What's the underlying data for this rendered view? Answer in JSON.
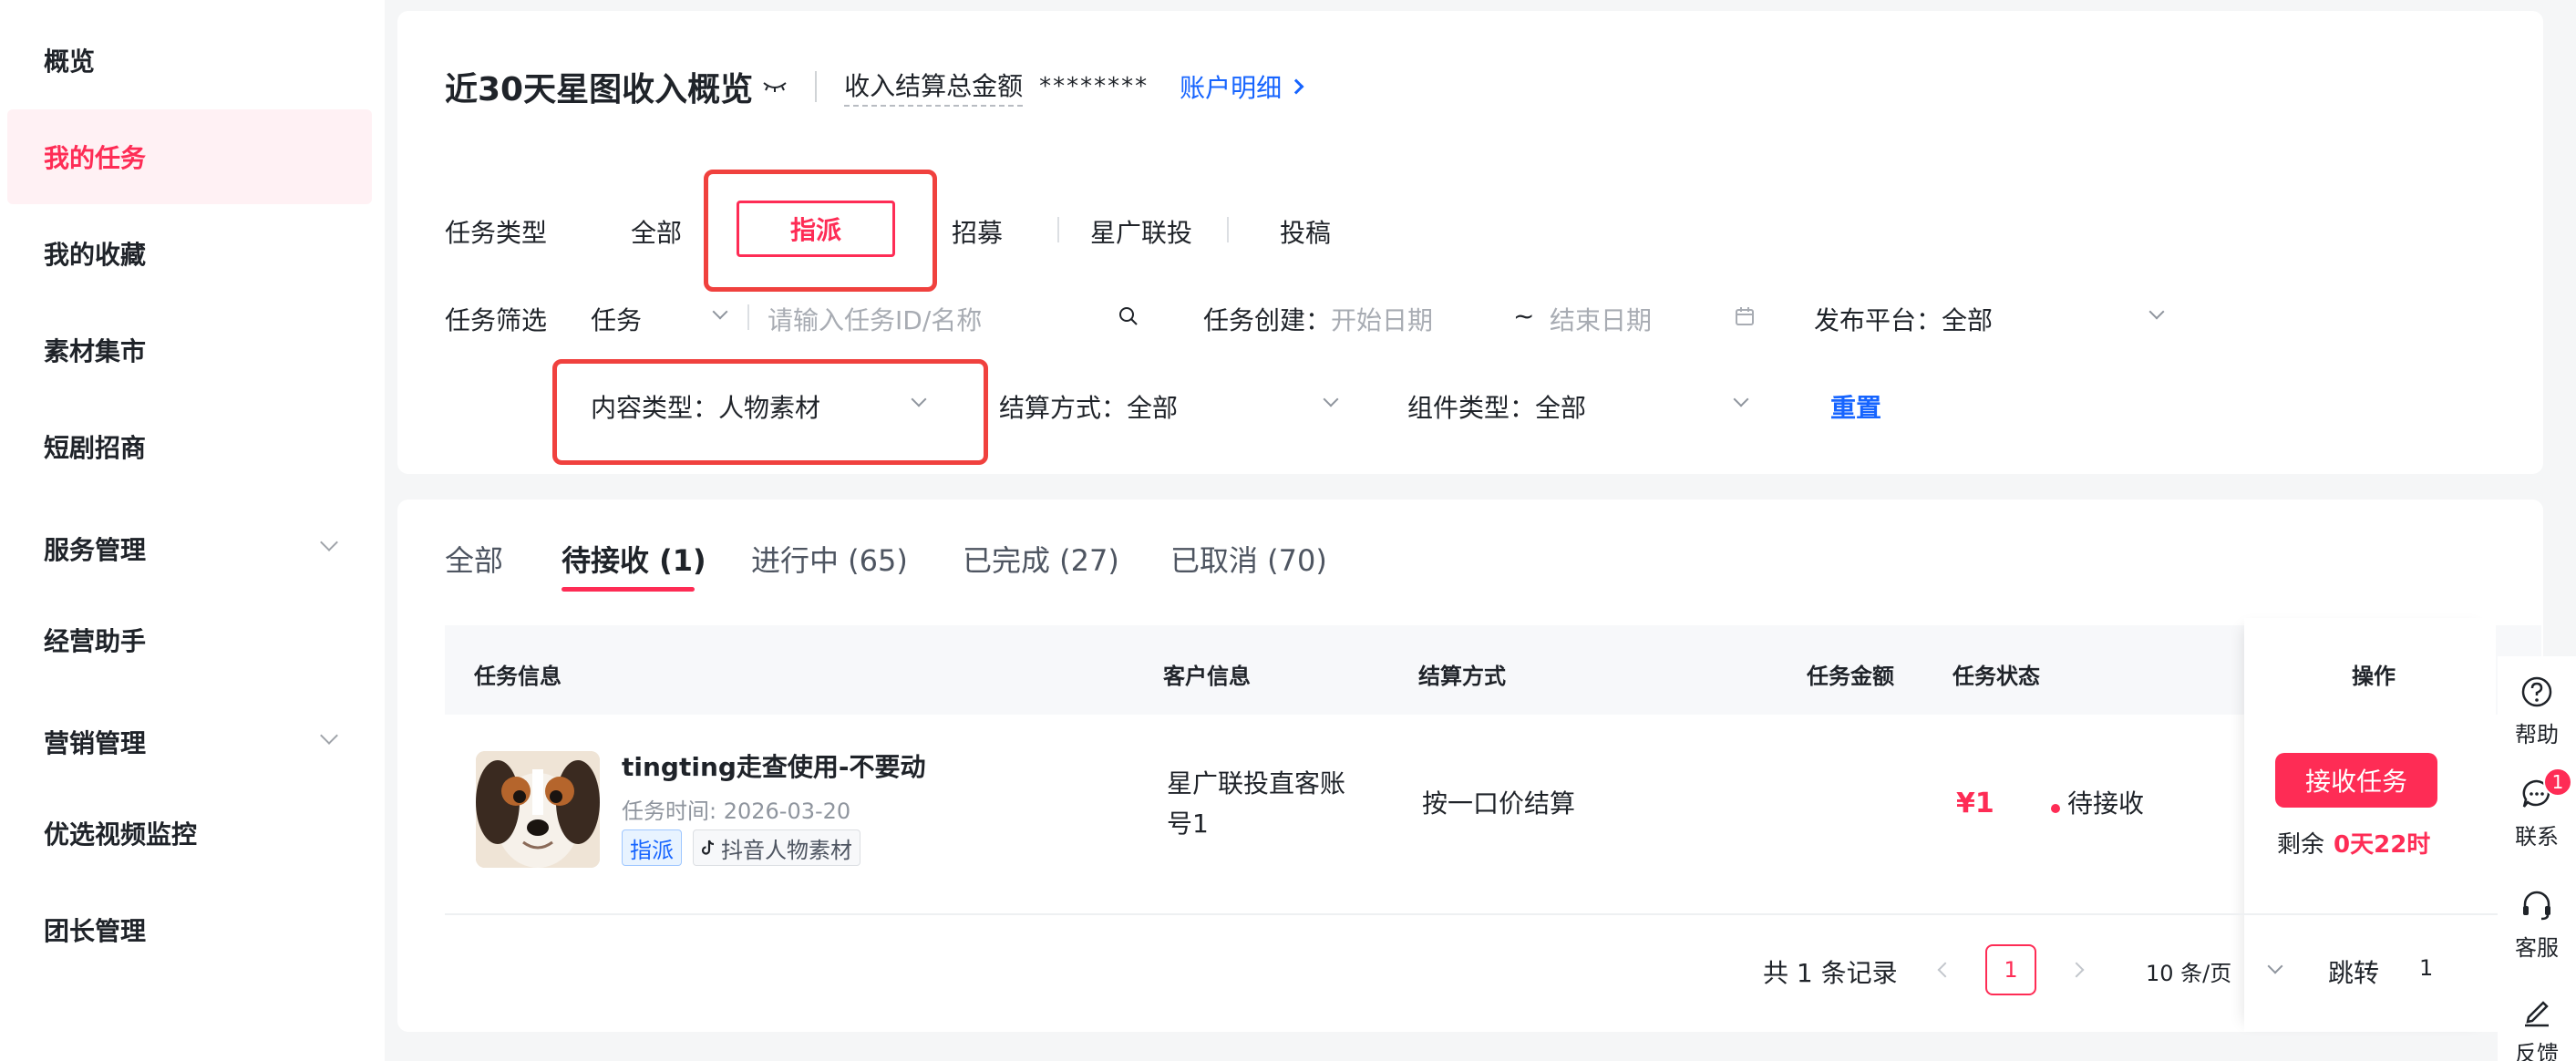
{
  "sidebar": {
    "items": [
      {
        "label": "概览"
      },
      {
        "label": "我的任务"
      },
      {
        "label": "我的收藏"
      },
      {
        "label": "素材集市"
      },
      {
        "label": "短剧招商"
      },
      {
        "label": "服务管理"
      },
      {
        "label": "经营助手"
      },
      {
        "label": "营销管理"
      },
      {
        "label": "优选视频监控"
      },
      {
        "label": "团长管理"
      }
    ],
    "active_index": 1
  },
  "header": {
    "title": "近30天星图收入概览",
    "settlement_label": "收入结算总金额",
    "settlement_value": "********",
    "account_link": "账户明细"
  },
  "filters": {
    "task_type_label": "任务类型",
    "task_types": [
      "全部",
      "指派",
      "招募",
      "星广联投",
      "投稿"
    ],
    "selected_task_type": "指派",
    "task_filter_label": "任务筛选",
    "task_select_value": "任务",
    "task_search_placeholder": "请输入任务ID/名称",
    "task_created_label": "任务创建：",
    "start_date_placeholder": "开始日期",
    "date_separator": "~",
    "end_date_placeholder": "结束日期",
    "platform_label": "发布平台：",
    "platform_value": "全部",
    "content_type_label": "内容类型：",
    "content_type_value": "人物素材",
    "settlement_label": "结算方式：",
    "settlement_value": "全部",
    "component_label": "组件类型：",
    "component_value": "全部",
    "reset": "重置"
  },
  "status_tabs": [
    {
      "label": "全部"
    },
    {
      "label": "待接收 (1)"
    },
    {
      "label": "进行中 (65)"
    },
    {
      "label": "已完成 (27)"
    },
    {
      "label": "已取消 (70)"
    }
  ],
  "active_status_tab": 1,
  "table": {
    "headers": {
      "task_info": "任务信息",
      "customer_info": "客户信息",
      "settlement": "结算方式",
      "amount": "任务金额",
      "status": "任务状态",
      "action": "操作"
    },
    "rows": [
      {
        "title": "tingting走查使用-不要动",
        "time": "任务时间: 2026-03-20",
        "tag_type": "指派",
        "tag_content": "抖音人物素材",
        "customer_line1": "星广联投直客账",
        "customer_line2": "号1",
        "settlement": "按一口价结算",
        "amount": "¥1",
        "status": "待接收",
        "action_button": "接收任务",
        "remaining_label": "剩余",
        "remaining_value": "0天22时"
      }
    ]
  },
  "pagination": {
    "total": "共 1 条记录",
    "current_page": "1",
    "page_size": "10 条/页",
    "jump_label": "跳转",
    "jump_value": "1"
  },
  "tool_rail": {
    "help": "帮助",
    "contact": "联系",
    "contact_badge": "1",
    "service": "客服",
    "feedback": "反馈"
  },
  "colors": {
    "accent": "#fe2c55",
    "link": "#1664ff",
    "highlight_box": "#f0413e"
  }
}
